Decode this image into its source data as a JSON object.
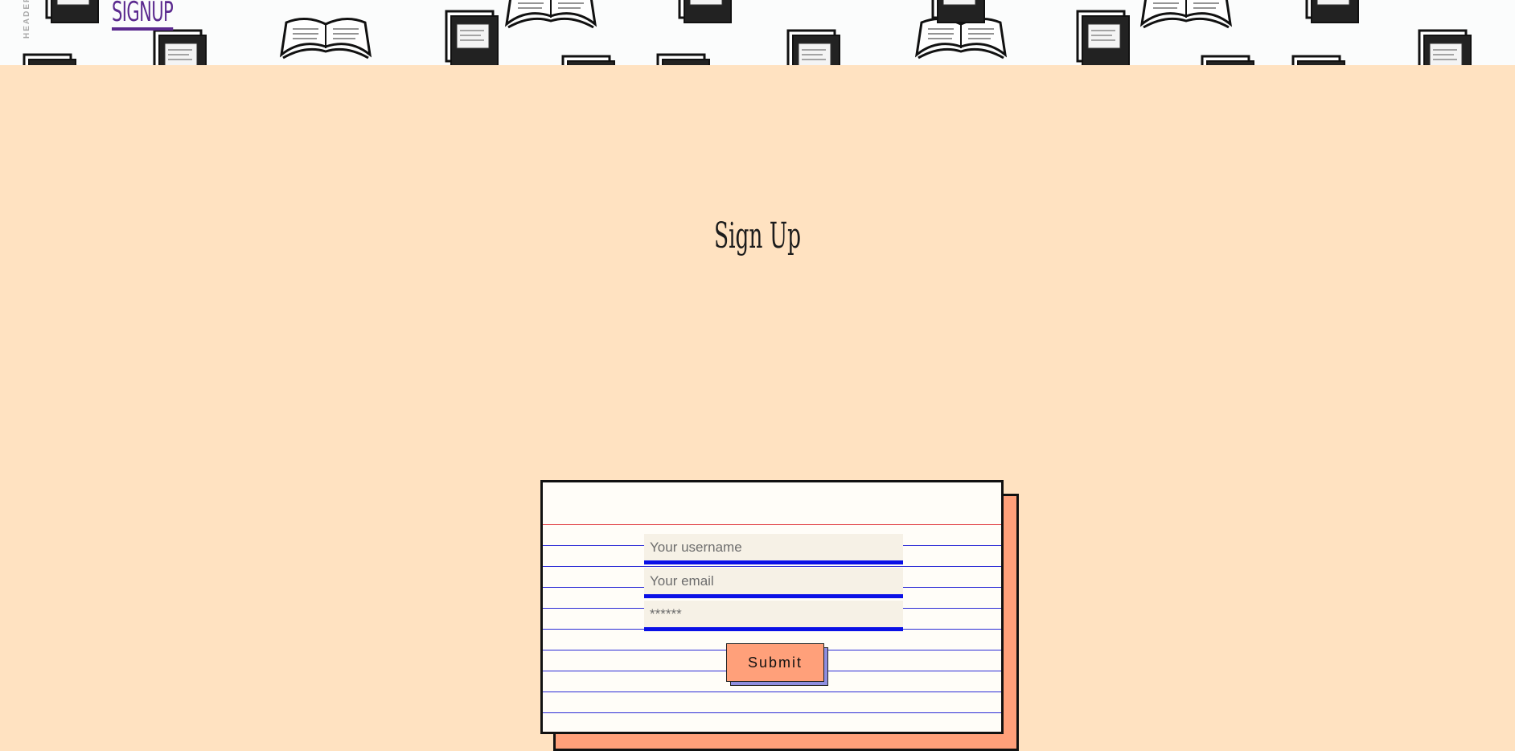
{
  "header": {
    "vertical_label": "HEADER",
    "nav_link": "SIGNUP",
    "pattern_icon": "sketched-books-pattern"
  },
  "page": {
    "title": "Sign Up"
  },
  "form": {
    "username_placeholder": "Your username",
    "email_placeholder": "Your email",
    "password_placeholder": "******",
    "submit_label": "Submit"
  },
  "colors": {
    "background": "#ffe2c1",
    "link": "#5b2a8f",
    "accent": "#ffa07a",
    "input_underline": "#0a10e6",
    "ruled_line": "#2b2bd6",
    "margin_line": "#e0393e"
  }
}
